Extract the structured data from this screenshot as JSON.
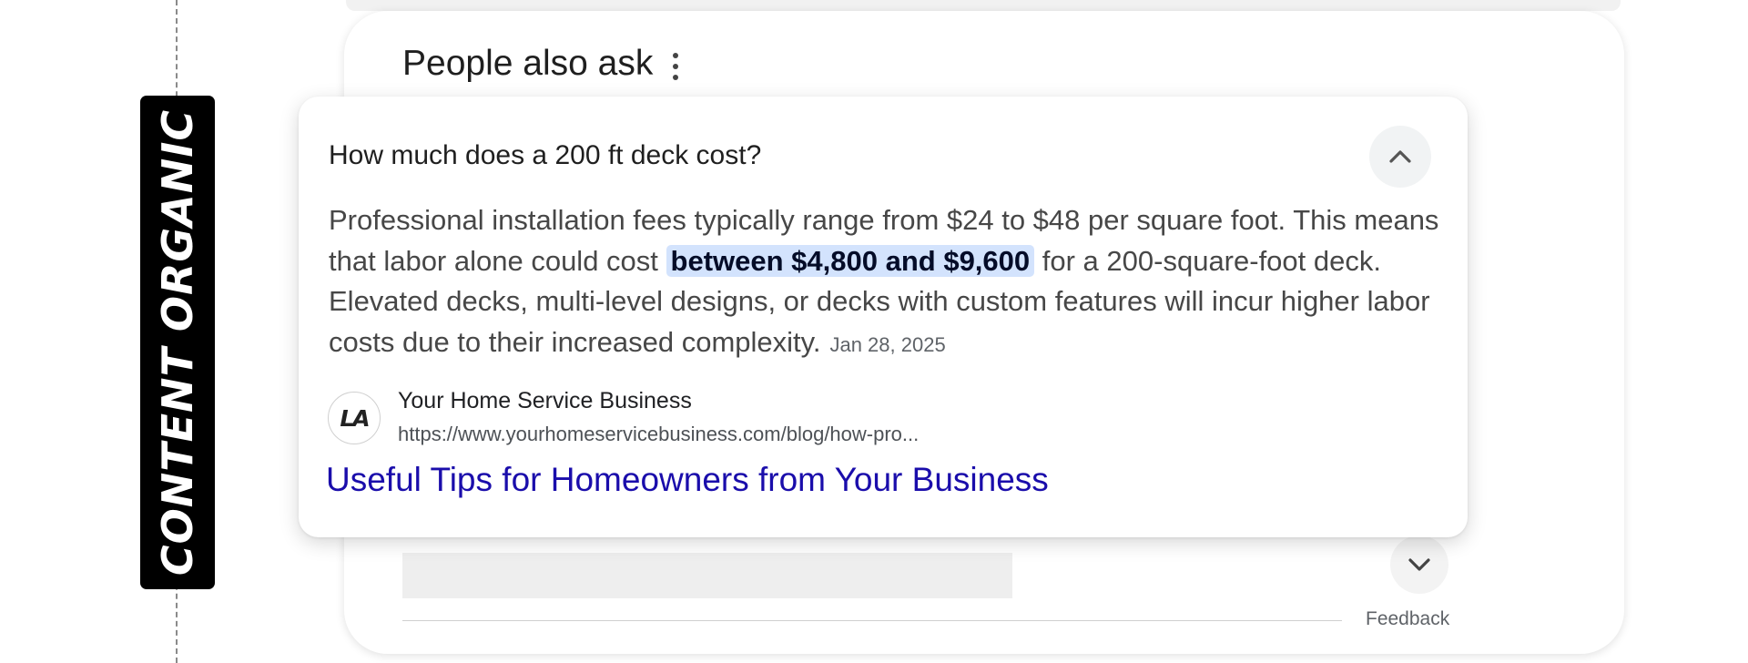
{
  "side_label": "CONTENT ORGANIC",
  "paa": {
    "title": "People also ask",
    "question": "How much does a 200 ft deck cost?",
    "answer_part1": "Professional installation fees typically range from $24 to $48 per square foot. This means that labor alone could cost ",
    "answer_highlight": "between $4,800 and $9,600",
    "answer_part2": " for a 200-square-foot deck. Elevated decks, multi-level designs, or decks with custom features will incur higher labor costs due to their increased complexity.",
    "date": "Jan 28, 2025",
    "source": {
      "logo_text": "LA",
      "name": "Your Home Service Business",
      "url": "https://www.yourhomeservicebusiness.com/blog/how-pro..."
    },
    "result_title": "Useful Tips for Homeowners from Your Business",
    "feedback_label": "Feedback"
  },
  "icons": {
    "more": "more-vert-icon",
    "collapse": "chevron-up-icon",
    "expand": "chevron-down-icon"
  }
}
